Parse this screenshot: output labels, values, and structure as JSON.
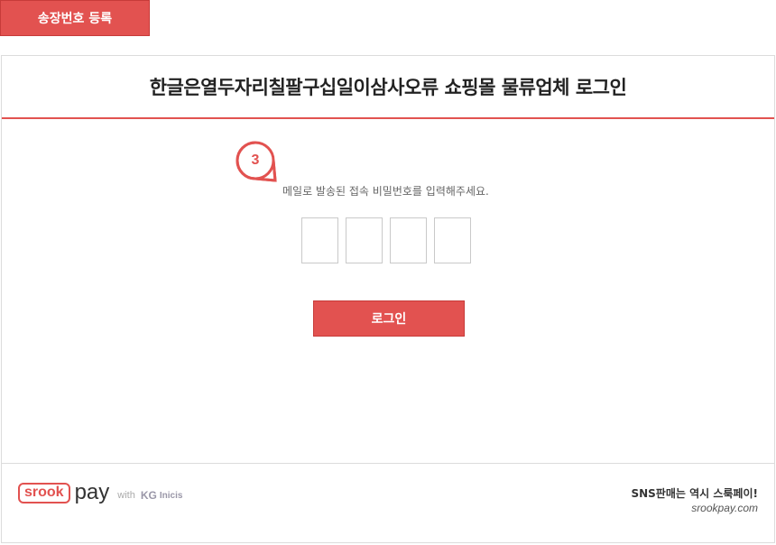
{
  "top_tab": {
    "label": "송장번호 등록"
  },
  "panel": {
    "title": "한글은열두자리칠팔구십일이삼사오류 쇼핑몰 물류업체 로그인",
    "step_number": "3",
    "instruction": "메일로 발송된 접속 비밀번호를 입력해주세요.",
    "code_boxes": [
      "",
      "",
      "",
      ""
    ],
    "login_label": "로그인"
  },
  "footer": {
    "logo": {
      "srook": "srook",
      "pay": "pay",
      "with": "with",
      "kg": "KG",
      "inicis": "Inicis"
    },
    "slogan_line1": "SNS판매는 역시 스룩페이!",
    "slogan_line2": "srookpay.com"
  },
  "colors": {
    "accent": "#e25250",
    "border": "#dcdcdc"
  }
}
